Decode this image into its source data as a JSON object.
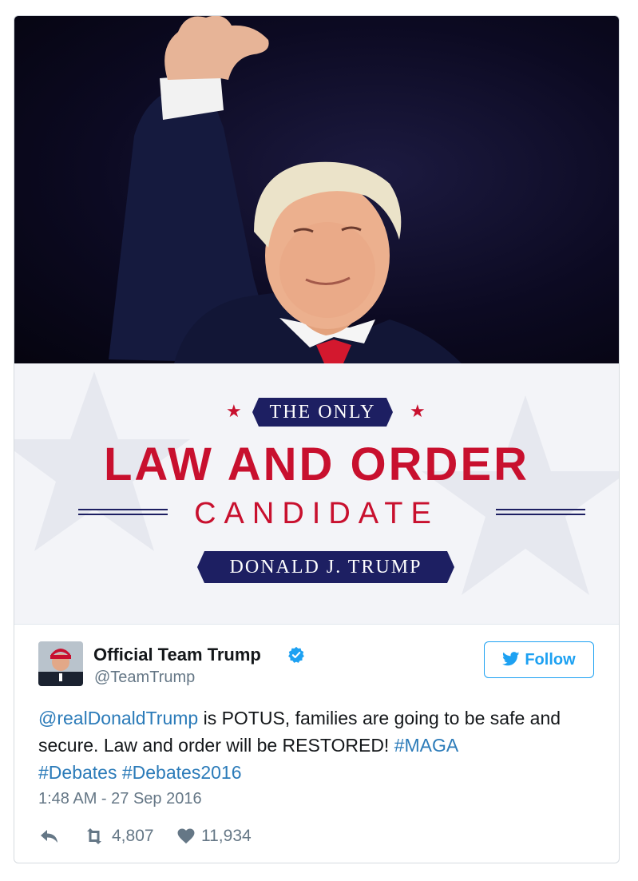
{
  "image": {
    "banner": {
      "top_tag": "THE ONLY",
      "headline": "LAW AND ORDER",
      "subheadline": "CANDIDATE",
      "name_tag": "DONALD J. TRUMP",
      "accent_red": "#c8102e",
      "accent_navy": "#1d1f62"
    }
  },
  "tweet": {
    "author": {
      "display_name": "Official Team Trump",
      "handle": "@TeamTrump",
      "verified_icon": "verified-badge-icon"
    },
    "follow_label": "Follow",
    "text": {
      "mention": "@realDonaldTrump",
      "segment_1": " is POTUS, families are going to be safe and secure. Law and order will be RESTORED! ",
      "hashtag_1": "#MAGA",
      "hashtag_2": "#Debates",
      "hashtag_3": "#Debates2016"
    },
    "timestamp": "1:48 AM - 27 Sep 2016",
    "actions": {
      "reply_icon": "reply-icon",
      "retweet_icon": "retweet-icon",
      "retweet_count": "4,807",
      "like_icon": "heart-icon",
      "like_count": "11,934"
    },
    "link_color": "#2b7bb9",
    "brand_color": "#1da1f2"
  }
}
